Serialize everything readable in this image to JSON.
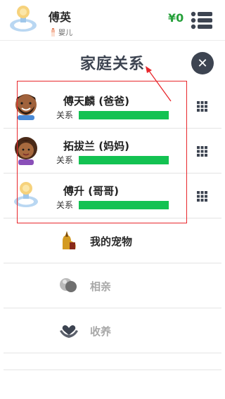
{
  "header": {
    "name": "傅英",
    "stage": "婴儿",
    "money": "¥0",
    "avatar_icon": "baby-pacifier-icon",
    "menu_icon": "menu-list-icon"
  },
  "dialog": {
    "title": "家庭关系",
    "close_glyph": "✕"
  },
  "members": [
    {
      "name": "傅天麟 (爸爸)",
      "relation_label": "关系",
      "relation_level": 1.0,
      "avatar": "father-avatar-icon"
    },
    {
      "name": "拓拔兰 (妈妈)",
      "relation_label": "关系",
      "relation_level": 1.0,
      "avatar": "mother-avatar-icon"
    },
    {
      "name": "傅升 (哥哥)",
      "relation_label": "关系",
      "relation_level": 1.0,
      "avatar": "baby-pacifier-icon"
    }
  ],
  "menu": [
    {
      "label": "我的宠物",
      "icon": "pet-dog-icon",
      "enabled": true
    },
    {
      "label": "相亲",
      "icon": "couple-icon",
      "enabled": false
    },
    {
      "label": "收养",
      "icon": "adopt-heart-hands-icon",
      "enabled": false
    }
  ],
  "colors": {
    "bar": "#13c252",
    "highlight": "#e8272c",
    "money": "#26a03a",
    "dark": "#3d4451"
  }
}
